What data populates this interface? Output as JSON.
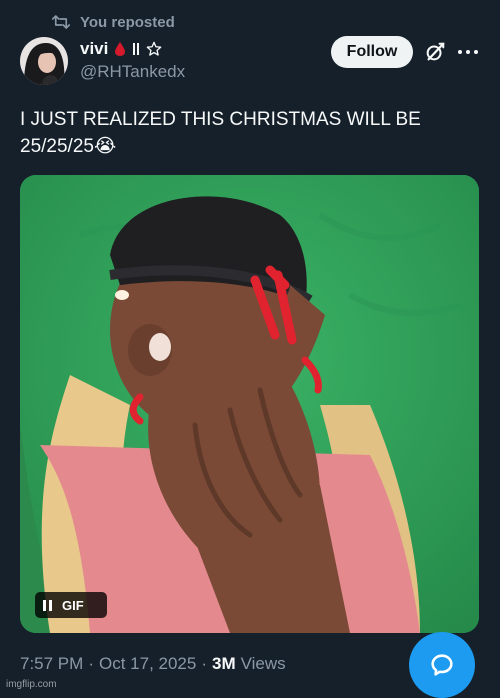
{
  "repost": {
    "icon": "repost-icon",
    "label": "You reposted"
  },
  "author": {
    "display_name": "vivi",
    "badges": [
      "blood-drop-icon",
      "double-bar-icon",
      "star-outline-icon"
    ],
    "handle": "@RHTankedx",
    "avatar_icon": "avatar"
  },
  "actions": {
    "follow_label": "Follow",
    "grok_icon": "grok-icon",
    "more_icon": "more-dots-icon"
  },
  "tweet": {
    "line1": "I JUST REALIZED THIS CHRISTMAS WILL BE",
    "line2": "25/25/25",
    "emoji": "😭"
  },
  "media": {
    "type": "gif",
    "badge_label": "GIF",
    "badge_icon": "pause-icon",
    "colors": {
      "background": "#2fa15a",
      "skin": "#7a4a36",
      "beanie": "#1f1f22",
      "hair": "#e8c98b",
      "nails": "#e0232f",
      "top": "#e48a8f"
    }
  },
  "meta": {
    "time": "7:57 PM",
    "sep1": "·",
    "date": "Oct 17, 2025",
    "sep2": "·",
    "views_count": "3M",
    "views_label": "Views"
  },
  "fab": {
    "icon": "reply-bubble-icon",
    "color": "#1d9bf0"
  },
  "watermark": "imgflip.com",
  "theme": {
    "background": "#15202b",
    "text": "#f7f9f9",
    "muted": "#8b98a5"
  }
}
